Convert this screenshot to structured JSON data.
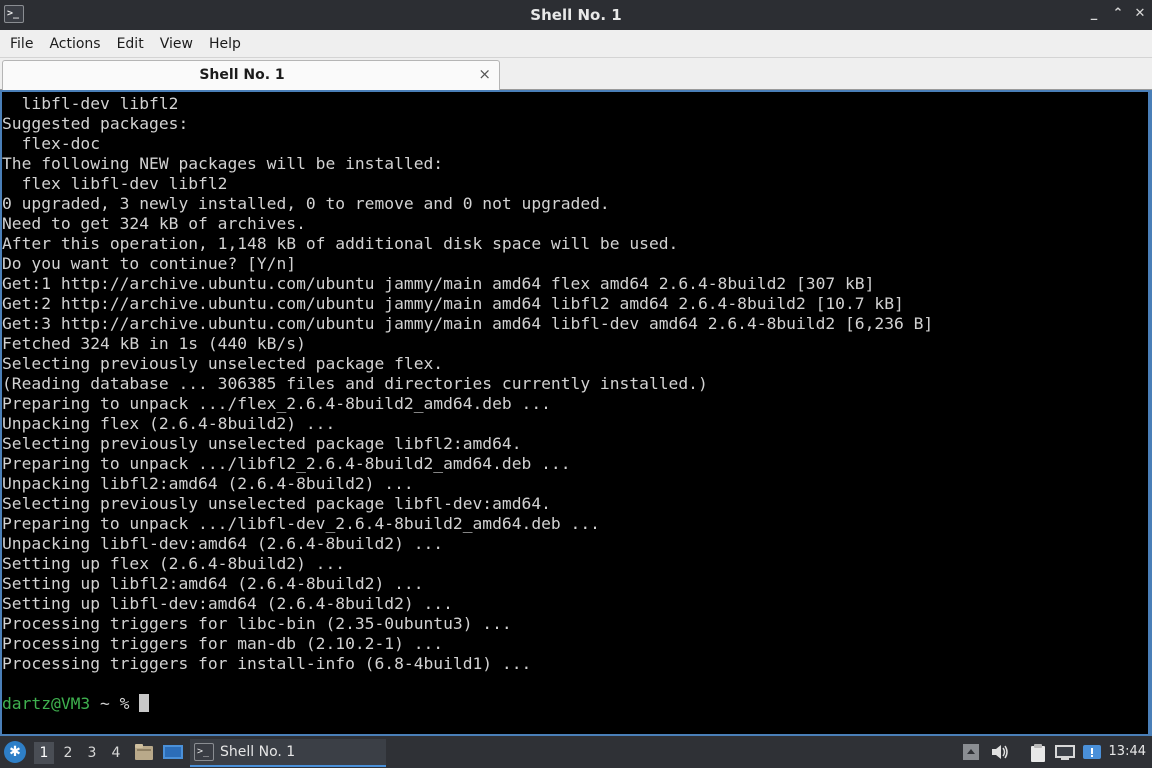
{
  "window": {
    "title": "Shell No. 1",
    "app_icon_glyph": ">_",
    "controls": {
      "minimize": "_",
      "restore": "⌃",
      "maximize": "▫",
      "close": "✕"
    }
  },
  "menu": [
    "File",
    "Actions",
    "Edit",
    "View",
    "Help"
  ],
  "tab": {
    "label": "Shell No. 1",
    "close": "×"
  },
  "terminal": {
    "lines": [
      "  libfl-dev libfl2",
      "Suggested packages:",
      "  flex-doc",
      "The following NEW packages will be installed:",
      "  flex libfl-dev libfl2",
      "0 upgraded, 3 newly installed, 0 to remove and 0 not upgraded.",
      "Need to get 324 kB of archives.",
      "After this operation, 1,148 kB of additional disk space will be used.",
      "Do you want to continue? [Y/n]",
      "Get:1 http://archive.ubuntu.com/ubuntu jammy/main amd64 flex amd64 2.6.4-8build2 [307 kB]",
      "Get:2 http://archive.ubuntu.com/ubuntu jammy/main amd64 libfl2 amd64 2.6.4-8build2 [10.7 kB]",
      "Get:3 http://archive.ubuntu.com/ubuntu jammy/main amd64 libfl-dev amd64 2.6.4-8build2 [6,236 B]",
      "Fetched 324 kB in 1s (440 kB/s)",
      "Selecting previously unselected package flex.",
      "(Reading database ... 306385 files and directories currently installed.)",
      "Preparing to unpack .../flex_2.6.4-8build2_amd64.deb ...",
      "Unpacking flex (2.6.4-8build2) ...",
      "Selecting previously unselected package libfl2:amd64.",
      "Preparing to unpack .../libfl2_2.6.4-8build2_amd64.deb ...",
      "Unpacking libfl2:amd64 (2.6.4-8build2) ...",
      "Selecting previously unselected package libfl-dev:amd64.",
      "Preparing to unpack .../libfl-dev_2.6.4-8build2_amd64.deb ...",
      "Unpacking libfl-dev:amd64 (2.6.4-8build2) ...",
      "Setting up flex (2.6.4-8build2) ...",
      "Setting up libfl2:amd64 (2.6.4-8build2) ...",
      "Setting up libfl-dev:amd64 (2.6.4-8build2) ...",
      "Processing triggers for libc-bin (2.35-0ubuntu3) ...",
      "Processing triggers for man-db (2.10.2-1) ...",
      "Processing triggers for install-info (6.8-4build1) ...",
      ""
    ],
    "prompt": {
      "user_host": "dartz@VM3",
      "rest": " ~ % "
    },
    "colors": {
      "background": "#000000",
      "text": "#d2d2d2",
      "prompt_user": "#3fb14f"
    }
  },
  "taskbar": {
    "menu_icon": "start-menu-icon",
    "workspaces": [
      "1",
      "2",
      "3",
      "4"
    ],
    "active_workspace": "1",
    "task": {
      "label": "Shell No. 1"
    },
    "clock": "13:44"
  }
}
